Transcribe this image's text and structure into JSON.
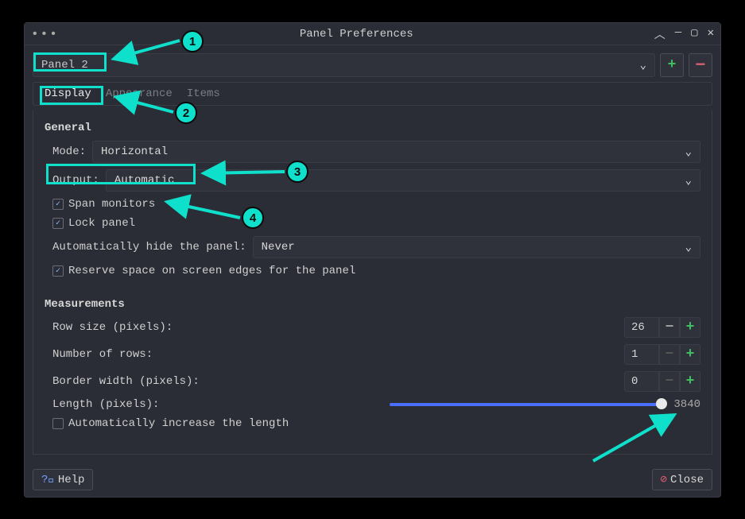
{
  "window": {
    "title": "Panel Preferences"
  },
  "panel_selector": {
    "value": "Panel 2"
  },
  "tabs": {
    "display": "Display",
    "appearance": "Appearance",
    "items": "Items"
  },
  "general": {
    "title": "General",
    "mode_label": "Mode:",
    "mode_value": "Horizontal",
    "output_label": "Output:",
    "output_value": "Automatic",
    "span_monitors_label": "Span monitors",
    "lock_panel_label": "Lock panel",
    "autohide_label": "Automatically hide the panel:",
    "autohide_value": "Never",
    "reserve_space_label": "Reserve space on screen edges for the panel"
  },
  "measurements": {
    "title": "Measurements",
    "row_size_label": "Row size (pixels):",
    "row_size_value": "26",
    "num_rows_label": "Number of rows:",
    "num_rows_value": "1",
    "border_width_label": "Border width (pixels):",
    "border_width_value": "0",
    "length_label": "Length (pixels):",
    "length_value": "3840",
    "auto_increase_label": "Automatically increase the length"
  },
  "footer": {
    "help_label": "Help",
    "close_label": "Close"
  },
  "annotations": {
    "n1": "1",
    "n2": "2",
    "n3": "3",
    "n4": "4"
  }
}
